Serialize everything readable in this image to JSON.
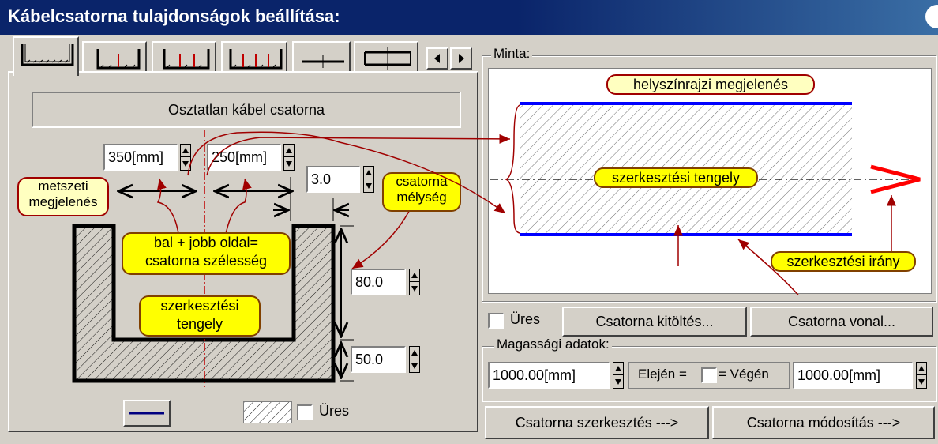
{
  "window": {
    "title": "Kábelcsatorna tulajdonságok beállítása:"
  },
  "tabs": {
    "names": [
      "Osztatlan csatorna",
      "Osztott 1",
      "Osztott 2",
      "Osztott 3",
      "Tengely 1",
      "Tengely 2"
    ],
    "active_index": 0
  },
  "left": {
    "type_label": "Osztatlan kábel csatorna",
    "left_width": "350[mm]",
    "right_width": "250[mm]",
    "wall_thickness": "3.0",
    "depth": "80.0",
    "bottom": "50.0",
    "annotations": {
      "section_view": [
        "metszeti",
        "megjelenés"
      ],
      "width_sum": [
        "bal + jobb oldal=",
        "csatorna szélesség"
      ],
      "depth": [
        "csatorna",
        "mélység"
      ],
      "axis": [
        "szerkesztési",
        "tengely"
      ]
    },
    "line_sample_color": "#000080",
    "empty_label": "Üres",
    "empty_checked": false
  },
  "sample": {
    "label": "Minta:",
    "plan_view": "helyszínrajzi megjelenés",
    "axis": "szerkesztési tengely",
    "direction": "szerkesztési irány",
    "edge_color": "#0000ff",
    "arrow_color": "#ff0000"
  },
  "fill_row": {
    "empty_label": "Üres",
    "empty_checked": false,
    "fill_button": "Csatorna kitöltés...",
    "line_button": "Csatorna vonal..."
  },
  "height": {
    "label": "Magassági adatok:",
    "start_value": "1000.00[mm]",
    "equal_left": "Elején =",
    "equal_right": "= Végén",
    "equal_checked": false,
    "end_value": "1000.00[mm]"
  },
  "actions": {
    "edit": "Csatorna szerkesztés --->",
    "modify": "Csatorna módosítás --->"
  }
}
